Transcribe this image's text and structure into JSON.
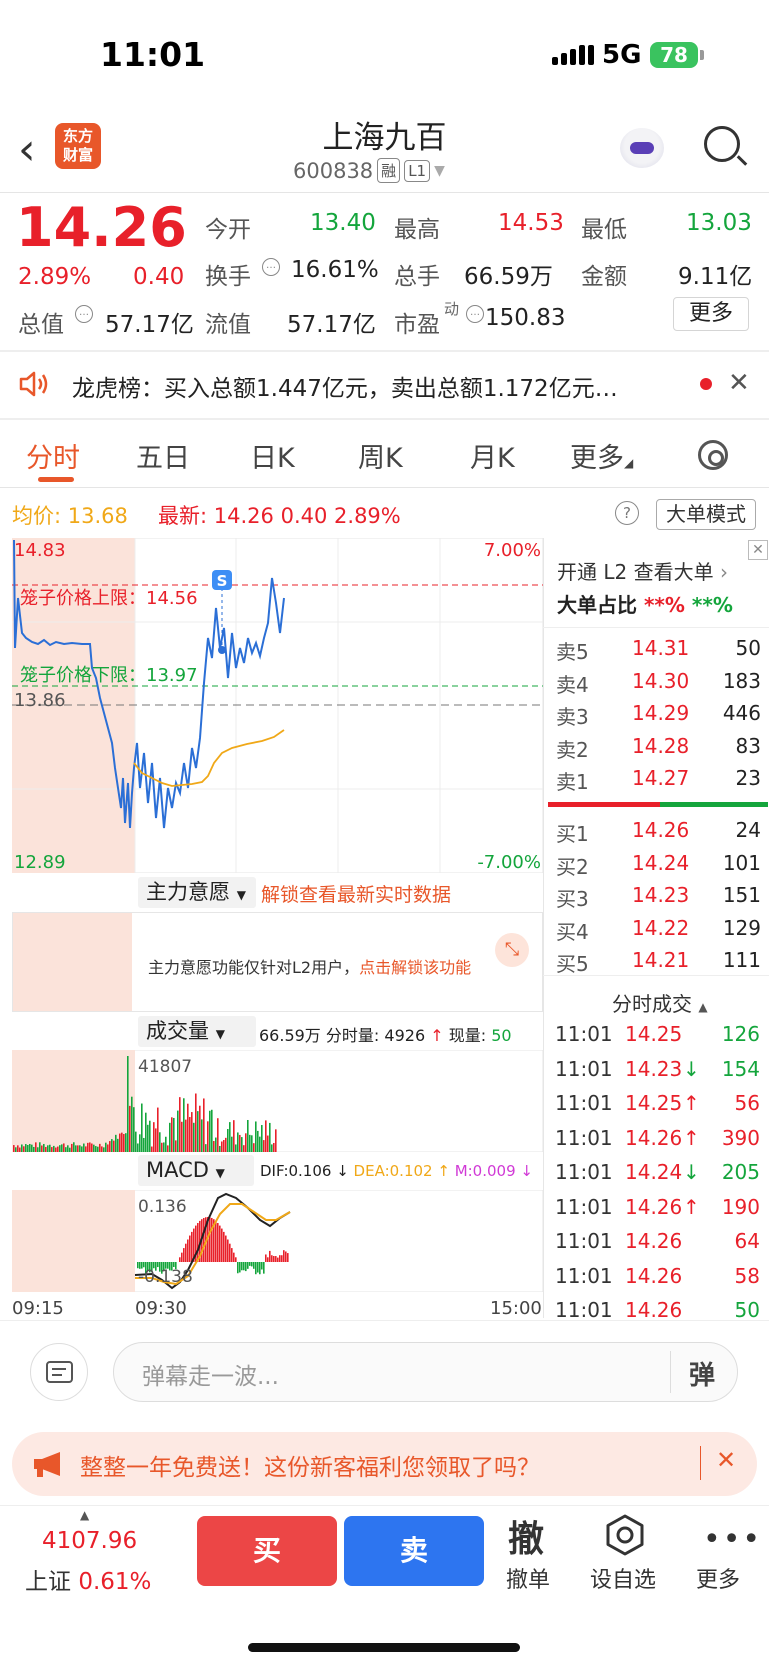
{
  "status_bar": {
    "time": "11:01",
    "network": "5G",
    "battery": "78"
  },
  "header": {
    "stock_name": "上海九百",
    "stock_code": "600838",
    "tag_rong": "融",
    "tag_level": "L1",
    "logo_line1": "东方",
    "logo_line2": "财富"
  },
  "quote": {
    "price": "14.26",
    "change_pct": "2.89%",
    "change": "0.40",
    "fields": [
      {
        "label": "今开",
        "value": "13.40",
        "color": "green"
      },
      {
        "label": "最高",
        "value": "14.53",
        "color": "red"
      },
      {
        "label": "最低",
        "value": "13.03",
        "color": "green"
      },
      {
        "label": "换手",
        "value": "16.61%",
        "color": "dark"
      },
      {
        "label": "总手",
        "value": "66.59万",
        "color": "dark"
      },
      {
        "label": "金额",
        "value": "9.11亿",
        "color": "dark"
      },
      {
        "label": "总值",
        "value": "57.17亿",
        "color": "dark"
      },
      {
        "label": "流值",
        "value": "57.17亿",
        "color": "dark"
      },
      {
        "label": "市盈",
        "value": "150.83",
        "color": "dark"
      }
    ],
    "pe_sup": "动",
    "more_label": "更多"
  },
  "announcement": {
    "text": "龙虎榜：买入总额1.447亿元，卖出总额1.172亿元…"
  },
  "tabs": [
    "分时",
    "五日",
    "日K",
    "周K",
    "月K",
    "更多"
  ],
  "chart_header": {
    "avg_label": "均价:",
    "avg_value": "13.68",
    "latest_label": "最新:",
    "latest_value": "14.26",
    "latest_change": "0.40",
    "latest_pct": "2.89%",
    "bigmode_label": "大单模式"
  },
  "chart_labels": {
    "y_top": "14.83",
    "y_mid": "13.86",
    "y_bottom": "12.89",
    "pct_top": "7.00%",
    "pct_bottom": "-7.00%",
    "upper_limit": "笼子价格上限：14.56",
    "lower_limit": "笼子价格下限：13.97",
    "s_marker": "S"
  },
  "chart_data": {
    "type": "line",
    "series": [
      {
        "name": "最新",
        "x": [
          "09:30",
          "09:40",
          "09:50",
          "10:00",
          "10:10",
          "10:20",
          "10:30",
          "10:40",
          "10:50",
          "11:01"
        ],
        "values": [
          13.4,
          13.05,
          13.3,
          13.1,
          13.4,
          13.8,
          14.1,
          14.4,
          14.2,
          14.26
        ]
      },
      {
        "name": "均价",
        "x": [
          "09:30",
          "09:40",
          "09:50",
          "10:00",
          "10:10",
          "10:20",
          "10:30",
          "10:40",
          "10:50",
          "11:01"
        ],
        "values": [
          13.4,
          13.33,
          13.3,
          13.3,
          13.33,
          13.45,
          13.55,
          13.62,
          13.66,
          13.68
        ]
      }
    ],
    "ylim": [
      12.89,
      14.83
    ],
    "xlabels": [
      "09:15",
      "09:30",
      "15:00"
    ]
  },
  "zhuli": {
    "selector": "主力意愿",
    "unlock_link": "解锁查看最新实时数据",
    "note": "主力意愿功能仅针对L2用户，",
    "note_link": "点击解锁该功能"
  },
  "volume": {
    "selector": "成交量",
    "total": "66.59万",
    "fenshi_label": "分时量:",
    "fenshi_value": "4926",
    "xian_label": "现量:",
    "xian_value": "50",
    "max_label": "41807"
  },
  "macd": {
    "selector": "MACD",
    "dif": "DIF:0.106",
    "dea": "DEA:0.102",
    "m": "M:0.009",
    "top_label": "0.136",
    "bottom_label": "-0.138"
  },
  "time_axis": [
    "09:15",
    "09:30",
    "15:00"
  ],
  "right_panel": {
    "l2_link": "开通 L2 查看大单",
    "big_order_label": "大单占比",
    "big_order_red": "**%",
    "big_order_green": "**%",
    "asks": [
      {
        "label": "卖5",
        "price": "14.31",
        "vol": "50"
      },
      {
        "label": "卖4",
        "price": "14.30",
        "vol": "183"
      },
      {
        "label": "卖3",
        "price": "14.29",
        "vol": "446"
      },
      {
        "label": "卖2",
        "price": "14.28",
        "vol": "83"
      },
      {
        "label": "卖1",
        "price": "14.27",
        "vol": "23"
      }
    ],
    "bids": [
      {
        "label": "买1",
        "price": "14.26",
        "vol": "24"
      },
      {
        "label": "买2",
        "price": "14.24",
        "vol": "101"
      },
      {
        "label": "买3",
        "price": "14.23",
        "vol": "151"
      },
      {
        "label": "买4",
        "price": "14.22",
        "vol": "129"
      },
      {
        "label": "买5",
        "price": "14.21",
        "vol": "111"
      }
    ],
    "ticks_title": "分时成交",
    "ticks": [
      {
        "time": "11:01",
        "price": "14.25",
        "arrow": "",
        "vol": "126",
        "vol_color": "green"
      },
      {
        "time": "11:01",
        "price": "14.23",
        "arrow": "↓",
        "vol": "154",
        "vol_color": "green"
      },
      {
        "time": "11:01",
        "price": "14.25",
        "arrow": "↑",
        "vol": "56",
        "vol_color": "red"
      },
      {
        "time": "11:01",
        "price": "14.26",
        "arrow": "↑",
        "vol": "390",
        "vol_color": "red"
      },
      {
        "time": "11:01",
        "price": "14.24",
        "arrow": "↓",
        "vol": "205",
        "vol_color": "green"
      },
      {
        "time": "11:01",
        "price": "14.26",
        "arrow": "↑",
        "vol": "190",
        "vol_color": "red"
      },
      {
        "time": "11:01",
        "price": "14.26",
        "arrow": "",
        "vol": "64",
        "vol_color": "red"
      },
      {
        "time": "11:01",
        "price": "14.26",
        "arrow": "",
        "vol": "58",
        "vol_color": "red"
      },
      {
        "time": "11:01",
        "price": "14.26",
        "arrow": "",
        "vol": "50",
        "vol_color": "green"
      }
    ]
  },
  "danmu": {
    "placeholder": "弹幕走一波...",
    "send_label": "弹"
  },
  "promo": {
    "text": "整整一年免费送！这份新客福利您领取了吗？"
  },
  "bottom_bar": {
    "index_value": "4107.96",
    "index_name": "上证",
    "index_pct": "0.61%",
    "buy": "买",
    "sell": "卖",
    "cancel_icon": "撤",
    "cancel": "撤单",
    "watch": "设自选",
    "more": "更多"
  },
  "colors": {
    "red": "#e8202a",
    "green": "#14a53c",
    "accent": "#e8572a",
    "price_line": "#2b6fd6",
    "avg_line": "#f0a818"
  }
}
